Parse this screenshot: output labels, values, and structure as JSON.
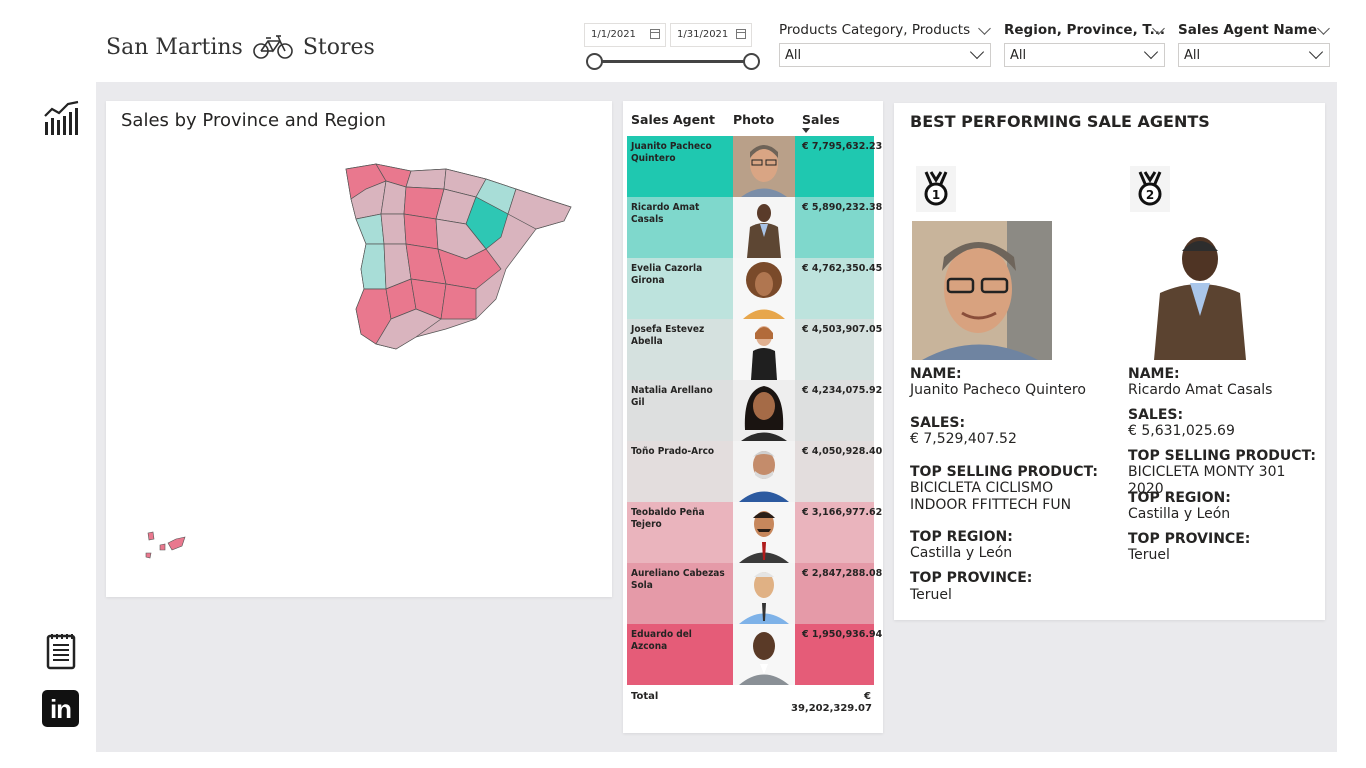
{
  "brand": {
    "name_left": "San Martins",
    "name_right": "Stores"
  },
  "filters": {
    "date_start": "1/1/2021",
    "date_end": "1/31/2021",
    "products": {
      "label": "Products Category, Products",
      "value": "All"
    },
    "region": {
      "label": "Region, Province, T...",
      "value": "All"
    },
    "agent": {
      "label": "Sales Agent Name",
      "value": "All"
    }
  },
  "map": {
    "title": "Sales by Province and Region",
    "colors": {
      "high": "#2ec7b4",
      "mid_high": "#a8ddd7",
      "neutral": "#d9b4be",
      "low": "#e9788e"
    }
  },
  "table": {
    "headers": {
      "agent": "Sales Agent",
      "photo": "Photo",
      "sales": "Sales"
    },
    "rows": [
      {
        "name": "Juanito Pacheco Quintero",
        "sales": "€ 7,795,632.23",
        "color": "#1fc8b0"
      },
      {
        "name": "Ricardo Amat Casals",
        "sales": "€ 5,890,232.38",
        "color": "#7fd8cc"
      },
      {
        "name": "Evelia Cazorla Girona",
        "sales": "€ 4,762,350.45",
        "color": "#bde3dd"
      },
      {
        "name": "Josefa Estevez Abella",
        "sales": "€ 4,503,907.05",
        "color": "#d5e1df"
      },
      {
        "name": "Natalia Arellano Gil",
        "sales": "€ 4,234,075.92",
        "color": "#dddfdf"
      },
      {
        "name": "Toño Prado-Arco",
        "sales": "€ 4,050,928.40",
        "color": "#e3dddd"
      },
      {
        "name": "Teobaldo Peña Tejero",
        "sales": "€ 3,166,977.62",
        "color": "#eab4bd"
      },
      {
        "name": "Aureliano Cabezas Sola",
        "sales": "€ 2,847,288.08",
        "color": "#e59aa8"
      },
      {
        "name": "Eduardo del Azcona",
        "sales": "€ 1,950,936.94",
        "color": "#e55c78"
      }
    ],
    "total_label": "Total",
    "total_value": "€ 39,202,329.07"
  },
  "best": {
    "title": "BEST PERFORMING SALE AGENTS",
    "labels": {
      "name": "NAME:",
      "sales": "SALES:",
      "top_product": "TOP SELLING PRODUCT:",
      "top_region": "TOP REGION:",
      "top_province": "TOP PROVINCE:"
    },
    "agents": [
      {
        "rank": "1",
        "name": "Juanito Pacheco Quintero",
        "sales": "€ 7,529,407.52",
        "top_product": "BICICLETA CICLISMO INDOOR FFITTECH FUN",
        "top_region": "Castilla y León",
        "top_province": "Teruel"
      },
      {
        "rank": "2",
        "name": "Ricardo Amat Casals",
        "sales": "€ 5,631,025.69",
        "top_product": "BICICLETA MONTY 301 2020",
        "top_region": "Castilla y León",
        "top_province": "Teruel"
      }
    ]
  },
  "nav": {
    "icons": [
      "chart-icon",
      "notes-icon",
      "linkedin-icon"
    ],
    "linkedin_text": "in"
  }
}
